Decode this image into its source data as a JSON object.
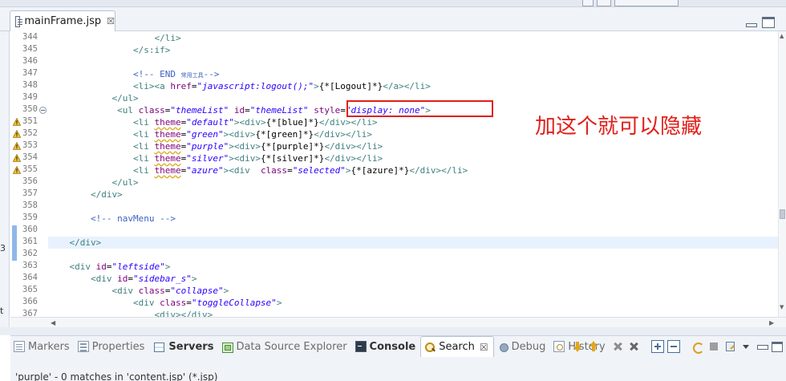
{
  "editor": {
    "tab_title": "mainFrame.jsp",
    "tab_close": "☒"
  },
  "left_fragments": [
    "3",
    "t"
  ],
  "code_lines": [
    {
      "n": "344",
      "marker": "",
      "fold": false,
      "current": false,
      "parts": [
        [
          "t",
          "                    "
        ],
        [
          "tag",
          "</li>"
        ]
      ]
    },
    {
      "n": "345",
      "marker": "",
      "fold": false,
      "current": false,
      "parts": [
        [
          "t",
          "                "
        ],
        [
          "tag",
          "</s:if>"
        ]
      ]
    },
    {
      "n": "346",
      "marker": "",
      "fold": false,
      "current": false,
      "parts": []
    },
    {
      "n": "347",
      "marker": "",
      "fold": false,
      "current": false,
      "parts": [
        [
          "t",
          "                "
        ],
        [
          "cmt",
          "<!-- END "
        ],
        [
          "cmtsmall",
          "常用工具"
        ],
        [
          "cmt",
          "-->"
        ]
      ]
    },
    {
      "n": "348",
      "marker": "",
      "fold": false,
      "current": false,
      "parts": [
        [
          "t",
          "                "
        ],
        [
          "tag",
          "<li><a "
        ],
        [
          "attr",
          "href"
        ],
        [
          "t",
          "="
        ],
        [
          "val",
          "\"javascript:logout();\""
        ],
        [
          "tag",
          ">"
        ],
        [
          "t",
          "{*[Logout]*}"
        ],
        [
          "tag",
          "</a></li>"
        ]
      ]
    },
    {
      "n": "349",
      "marker": "",
      "fold": false,
      "current": false,
      "parts": [
        [
          "t",
          "            "
        ],
        [
          "tag",
          "</ul>"
        ]
      ]
    },
    {
      "n": "350",
      "marker": "",
      "fold": true,
      "current": false,
      "parts": [
        [
          "t",
          "             "
        ],
        [
          "tag",
          "<ul "
        ],
        [
          "attr",
          "class"
        ],
        [
          "t",
          "="
        ],
        [
          "val",
          "\"themeList\""
        ],
        [
          "t",
          " "
        ],
        [
          "attr",
          "id"
        ],
        [
          "t",
          "="
        ],
        [
          "val",
          "\"themeList\""
        ],
        [
          "t",
          " "
        ],
        [
          "attr",
          "style"
        ],
        [
          "t",
          "="
        ],
        [
          "val",
          "\"display: none\""
        ],
        [
          "tag",
          ">"
        ]
      ]
    },
    {
      "n": "351",
      "marker": "warning",
      "fold": false,
      "current": false,
      "parts": [
        [
          "t",
          "                "
        ],
        [
          "tag",
          "<li "
        ],
        [
          "attru",
          "theme"
        ],
        [
          "t",
          "="
        ],
        [
          "val",
          "\"default\""
        ],
        [
          "tag",
          "><div>"
        ],
        [
          "t",
          "{*[blue]*}"
        ],
        [
          "tag",
          "</div></li>"
        ]
      ]
    },
    {
      "n": "352",
      "marker": "warning",
      "fold": false,
      "current": false,
      "parts": [
        [
          "t",
          "                "
        ],
        [
          "tag",
          "<li "
        ],
        [
          "attru",
          "theme"
        ],
        [
          "t",
          "="
        ],
        [
          "val",
          "\"green\""
        ],
        [
          "tag",
          "><div>"
        ],
        [
          "t",
          "{*[green]*}"
        ],
        [
          "tag",
          "</div></li>"
        ]
      ]
    },
    {
      "n": "353",
      "marker": "warning",
      "fold": false,
      "current": false,
      "parts": [
        [
          "t",
          "                "
        ],
        [
          "tag",
          "<li "
        ],
        [
          "attru",
          "theme"
        ],
        [
          "t",
          "="
        ],
        [
          "val",
          "\"purple\""
        ],
        [
          "tag",
          "><div>"
        ],
        [
          "t",
          "{*[purple]*}"
        ],
        [
          "tag",
          "</div></li>"
        ]
      ]
    },
    {
      "n": "354",
      "marker": "warning",
      "fold": false,
      "current": false,
      "parts": [
        [
          "t",
          "                "
        ],
        [
          "tag",
          "<li "
        ],
        [
          "attru",
          "theme"
        ],
        [
          "t",
          "="
        ],
        [
          "val",
          "\"silver\""
        ],
        [
          "tag",
          "><div>"
        ],
        [
          "t",
          "{*[silver]*}"
        ],
        [
          "tag",
          "</div></li>"
        ]
      ]
    },
    {
      "n": "355",
      "marker": "warning",
      "fold": false,
      "current": false,
      "parts": [
        [
          "t",
          "                "
        ],
        [
          "tag",
          "<li "
        ],
        [
          "attru",
          "theme"
        ],
        [
          "t",
          "="
        ],
        [
          "val",
          "\"azure\""
        ],
        [
          "tag",
          "><div  "
        ],
        [
          "attr",
          "class"
        ],
        [
          "t",
          "="
        ],
        [
          "val",
          "\"selected\""
        ],
        [
          "tag",
          ">"
        ],
        [
          "t",
          "{*[azure]*}"
        ],
        [
          "tag",
          "</div></li>"
        ]
      ]
    },
    {
      "n": "356",
      "marker": "",
      "fold": false,
      "current": false,
      "parts": [
        [
          "t",
          "            "
        ],
        [
          "tag",
          "</ul>"
        ]
      ]
    },
    {
      "n": "357",
      "marker": "",
      "fold": false,
      "current": false,
      "parts": [
        [
          "t",
          "        "
        ],
        [
          "tag",
          "</div>"
        ]
      ]
    },
    {
      "n": "358",
      "marker": "",
      "fold": false,
      "current": false,
      "parts": []
    },
    {
      "n": "359",
      "marker": "",
      "fold": false,
      "current": false,
      "parts": [
        [
          "t",
          "        "
        ],
        [
          "cmt",
          "<!-- navMenu -->"
        ]
      ]
    },
    {
      "n": "360",
      "marker": "",
      "fold": false,
      "current": false,
      "parts": []
    },
    {
      "n": "361",
      "marker": "",
      "fold": false,
      "current": true,
      "parts": [
        [
          "t",
          "    "
        ],
        [
          "tag",
          "</div>"
        ]
      ]
    },
    {
      "n": "362",
      "marker": "",
      "fold": false,
      "current": false,
      "parts": []
    },
    {
      "n": "363",
      "marker": "",
      "fold": false,
      "current": false,
      "parts": [
        [
          "t",
          "    "
        ],
        [
          "tag",
          "<div "
        ],
        [
          "attr",
          "id"
        ],
        [
          "t",
          "="
        ],
        [
          "val",
          "\"leftside\""
        ],
        [
          "tag",
          ">"
        ]
      ]
    },
    {
      "n": "364",
      "marker": "",
      "fold": false,
      "current": false,
      "parts": [
        [
          "t",
          "        "
        ],
        [
          "tag",
          "<div "
        ],
        [
          "attr",
          "id"
        ],
        [
          "t",
          "="
        ],
        [
          "val",
          "\"sidebar_s\""
        ],
        [
          "tag",
          ">"
        ]
      ]
    },
    {
      "n": "365",
      "marker": "",
      "fold": false,
      "current": false,
      "parts": [
        [
          "t",
          "            "
        ],
        [
          "tag",
          "<div "
        ],
        [
          "attr",
          "class"
        ],
        [
          "t",
          "="
        ],
        [
          "val",
          "\"collapse\""
        ],
        [
          "tag",
          ">"
        ]
      ]
    },
    {
      "n": "366",
      "marker": "",
      "fold": false,
      "current": false,
      "parts": [
        [
          "t",
          "                "
        ],
        [
          "tag",
          "<div "
        ],
        [
          "attr",
          "class"
        ],
        [
          "t",
          "="
        ],
        [
          "val",
          "\"toggleCollapse\""
        ],
        [
          "tag",
          ">"
        ]
      ]
    },
    {
      "n": "367",
      "marker": "",
      "fold": false,
      "current": false,
      "parts": [
        [
          "t",
          "                    "
        ],
        [
          "tag",
          "<div></div>"
        ]
      ]
    }
  ],
  "annotation": {
    "text": "加这个就可以隐藏",
    "color": "#e0201a"
  },
  "panel": {
    "tabs": [
      {
        "label": "Markers",
        "icon": "markers-icon",
        "active": false,
        "bold": false
      },
      {
        "label": "Properties",
        "icon": "properties-icon",
        "active": false,
        "bold": false
      },
      {
        "label": "Servers",
        "icon": "servers-icon",
        "active": false,
        "bold": true
      },
      {
        "label": "Data Source Explorer",
        "icon": "data-source-explorer-icon",
        "active": false,
        "bold": false
      },
      {
        "label": "Console",
        "icon": "console-icon",
        "active": false,
        "bold": true
      },
      {
        "label": "Search",
        "icon": "search-icon",
        "active": true,
        "bold": false,
        "close": "☒"
      },
      {
        "label": "Debug",
        "icon": "debug-icon",
        "active": false,
        "bold": false
      },
      {
        "label": "History",
        "icon": "history-icon",
        "active": false,
        "bold": false
      }
    ],
    "search_status": "'purple' - 0 matches in 'content.jsp' (*.jsp)"
  },
  "colors": {
    "tag": "#3f7f7f",
    "attribute": "#7f007f",
    "value": "#2a00ff",
    "comment": "#3f5fbf",
    "current_line": "#e8f2fe",
    "warning": "#e2a617"
  }
}
